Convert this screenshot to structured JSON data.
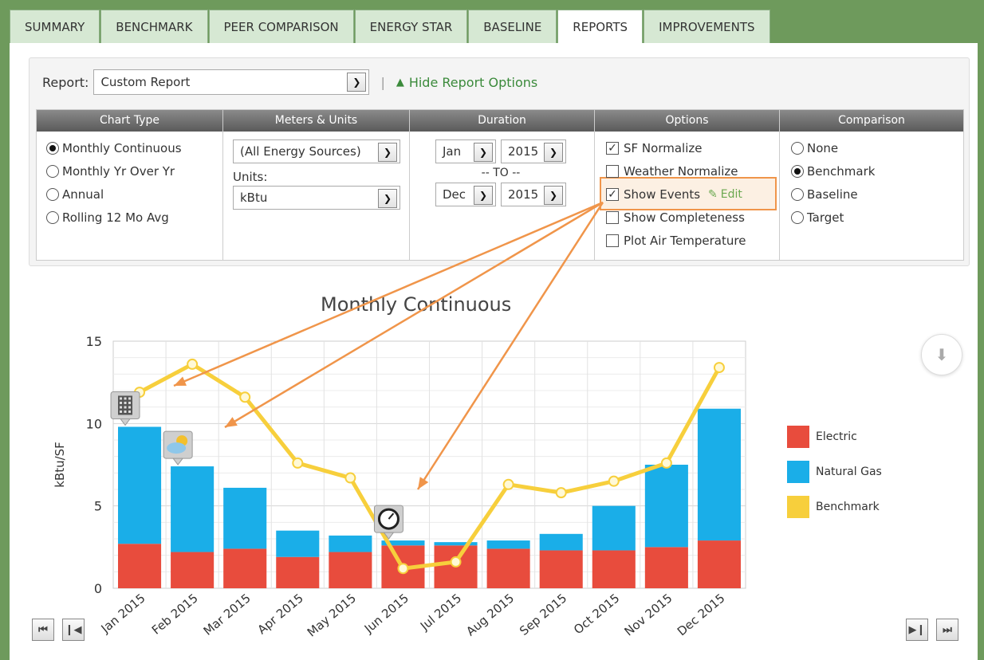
{
  "tabs": [
    {
      "label": "SUMMARY",
      "active": false
    },
    {
      "label": "BENCHMARK",
      "active": false
    },
    {
      "label": "PEER COMPARISON",
      "active": false
    },
    {
      "label": "ENERGY STAR",
      "active": false
    },
    {
      "label": "BASELINE",
      "active": false
    },
    {
      "label": "REPORTS",
      "active": true
    },
    {
      "label": "IMPROVEMENTS",
      "active": false
    }
  ],
  "report": {
    "label": "Report:",
    "selected": "Custom Report",
    "separator": "|",
    "hide_options_label": "Hide Report Options"
  },
  "options": {
    "chart_type": {
      "header": "Chart Type",
      "items": [
        "Monthly Continuous",
        "Monthly Yr Over Yr",
        "Annual",
        "Rolling 12 Mo Avg"
      ],
      "selected_index": 0
    },
    "meters_units": {
      "header": "Meters & Units",
      "source_selected": "(All Energy Sources)",
      "units_label": "Units:",
      "units_selected": "kBtu"
    },
    "duration": {
      "header": "Duration",
      "start_month": "Jan",
      "start_year": "2015",
      "to_label": "-- TO --",
      "end_month": "Dec",
      "end_year": "2015"
    },
    "options_col": {
      "header": "Options",
      "items": [
        {
          "label": "SF Normalize",
          "checked": true
        },
        {
          "label": "Weather Normalize",
          "checked": false
        },
        {
          "label": "Show Events",
          "checked": true
        },
        {
          "label": "Show Completeness",
          "checked": false
        },
        {
          "label": "Plot Air Temperature",
          "checked": false
        }
      ],
      "edit_label": "Edit"
    },
    "comparison": {
      "header": "Comparison",
      "items": [
        "None",
        "Benchmark",
        "Baseline",
        "Target"
      ],
      "selected_index": 1
    }
  },
  "colors": {
    "electric": "#e84c3d",
    "natural_gas": "#1aaee8",
    "benchmark": "#f7cf3c",
    "annotation": "#f0954a"
  },
  "chart_data": {
    "type": "bar",
    "title": "Monthly Continuous",
    "ylabel": "kBtu/SF",
    "xlabel": "",
    "ylim": [
      0,
      15
    ],
    "yticks": [
      0,
      5,
      10,
      15
    ],
    "categories": [
      "Jan 2015",
      "Feb 2015",
      "Mar 2015",
      "Apr 2015",
      "May 2015",
      "Jun 2015",
      "Jul 2015",
      "Aug 2015",
      "Sep 2015",
      "Oct 2015",
      "Nov 2015",
      "Dec 2015"
    ],
    "stacked": true,
    "series": [
      {
        "name": "Electric",
        "kind": "bar",
        "values": [
          2.7,
          2.2,
          2.4,
          1.9,
          2.2,
          2.6,
          2.6,
          2.4,
          2.3,
          2.3,
          2.5,
          2.9
        ]
      },
      {
        "name": "Natural Gas",
        "kind": "bar",
        "values": [
          7.1,
          5.2,
          3.7,
          1.6,
          1.0,
          0.3,
          0.2,
          0.5,
          1.0,
          2.7,
          5.0,
          8.0
        ]
      },
      {
        "name": "Benchmark",
        "kind": "line",
        "values": [
          11.9,
          13.6,
          11.6,
          7.6,
          6.7,
          1.2,
          1.6,
          6.3,
          5.8,
          6.5,
          7.6,
          13.4
        ]
      }
    ],
    "legend": "right",
    "grid": true,
    "events": [
      {
        "month_index": 0,
        "icon": "building-event-icon"
      },
      {
        "month_index": 1,
        "icon": "weather-event-icon"
      },
      {
        "month_index": 5,
        "icon": "meter-gauge-event-icon"
      }
    ]
  }
}
